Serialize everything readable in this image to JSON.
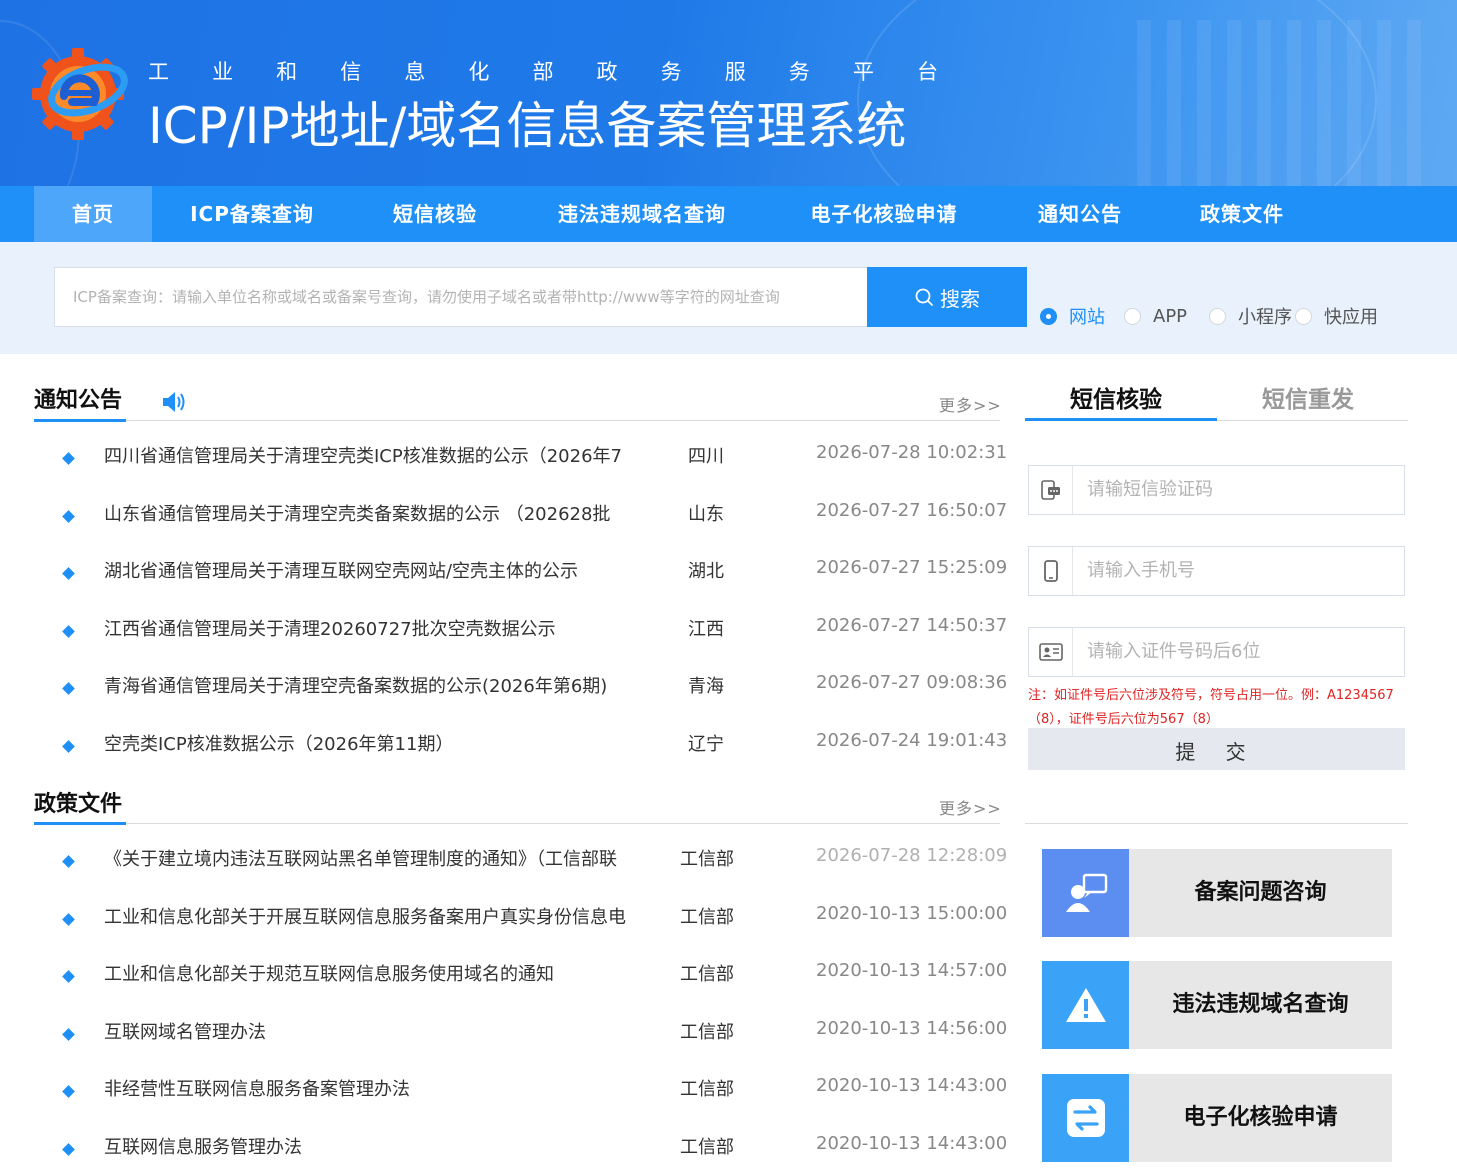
{
  "header": {
    "subtitle_chars": [
      "工",
      "业",
      "和",
      "信",
      "息",
      "化",
      "部",
      "政",
      "务",
      "服",
      "务",
      "平",
      "台"
    ],
    "title": "ICP/IP地址/域名信息备案管理系统"
  },
  "nav": {
    "items": [
      "首页",
      "ICP备案查询",
      "短信核验",
      "违法违规域名查询",
      "电子化核验申请",
      "通知公告",
      "政策文件"
    ]
  },
  "search": {
    "placeholder": "ICP备案查询：请输入单位名称或域名或备案号查询，请勿使用子域名或者带http://www等字符的网址查询",
    "button_label": "搜索",
    "options": [
      "网站",
      "APP",
      "小程序",
      "快应用"
    ],
    "selected": "网站"
  },
  "notices": {
    "title": "通知公告",
    "more": "更多>>",
    "rows": [
      {
        "title": "四川省通信管理局关于清理空壳类ICP核准数据的公示（2026年7",
        "source": "四川",
        "date": "2026-07-28 10:02:31"
      },
      {
        "title": "山东省通信管理局关于清理空壳类备案数据的公示 （202628批",
        "source": "山东",
        "date": "2026-07-27 16:50:07"
      },
      {
        "title": "湖北省通信管理局关于清理互联网空壳网站/空壳主体的公示",
        "source": "湖北",
        "date": "2026-07-27 15:25:09"
      },
      {
        "title": "江西省通信管理局关于清理20260727批次空壳数据公示",
        "source": "江西",
        "date": "2026-07-27 14:50:37"
      },
      {
        "title": "青海省通信管理局关于清理空壳备案数据的公示(2026年第6期)",
        "source": "青海",
        "date": "2026-07-27 09:08:36"
      },
      {
        "title": "空壳类ICP核准数据公示（2026年第11期）",
        "source": "辽宁",
        "date": "2026-07-24 19:01:43"
      }
    ]
  },
  "policies": {
    "title": "政策文件",
    "more": "更多>>",
    "rows": [
      {
        "title": "《关于建立境内违法互联网站黑名单管理制度的通知》（工信部联",
        "source": "工信部",
        "date": "2026-07-28 12:28:09"
      },
      {
        "title": "工业和信息化部关于开展互联网信息服务备案用户真实身份信息电",
        "source": "工信部",
        "date": "2020-10-13 15:00:00"
      },
      {
        "title": "工业和信息化部关于规范互联网信息服务使用域名的通知",
        "source": "工信部",
        "date": "2020-10-13 14:57:00"
      },
      {
        "title": "互联网域名管理办法",
        "source": "工信部",
        "date": "2020-10-13 14:56:00"
      },
      {
        "title": "非经营性互联网信息服务备案管理办法",
        "source": "工信部",
        "date": "2020-10-13 14:43:00"
      },
      {
        "title": "互联网信息服务管理办法",
        "source": "工信部",
        "date": "2020-10-13 14:43:00"
      }
    ]
  },
  "sms": {
    "tabs": [
      "短信核验",
      "短信重发"
    ],
    "fields": [
      {
        "placeholder": "请输短信验证码",
        "icon": "sms-icon"
      },
      {
        "placeholder": "请输入手机号",
        "icon": "phone-icon"
      },
      {
        "placeholder": "请输入证件号码后6位",
        "icon": "id-card-icon"
      }
    ],
    "note_line1": "注：如证件号后六位涉及符号，符号占用一位。例：A1234567",
    "note_line2": "（8），证件号后六位为567（8）",
    "submit": "提 交"
  },
  "cards": [
    {
      "label": "备案问题咨询",
      "icon": "consult-icon",
      "color": "#5b8ef0"
    },
    {
      "label": "违法违规域名查询",
      "icon": "warning-icon",
      "color": "#3aa3f7"
    },
    {
      "label": "电子化核验申请",
      "icon": "exchange-icon",
      "color": "#3aa3f7"
    }
  ]
}
